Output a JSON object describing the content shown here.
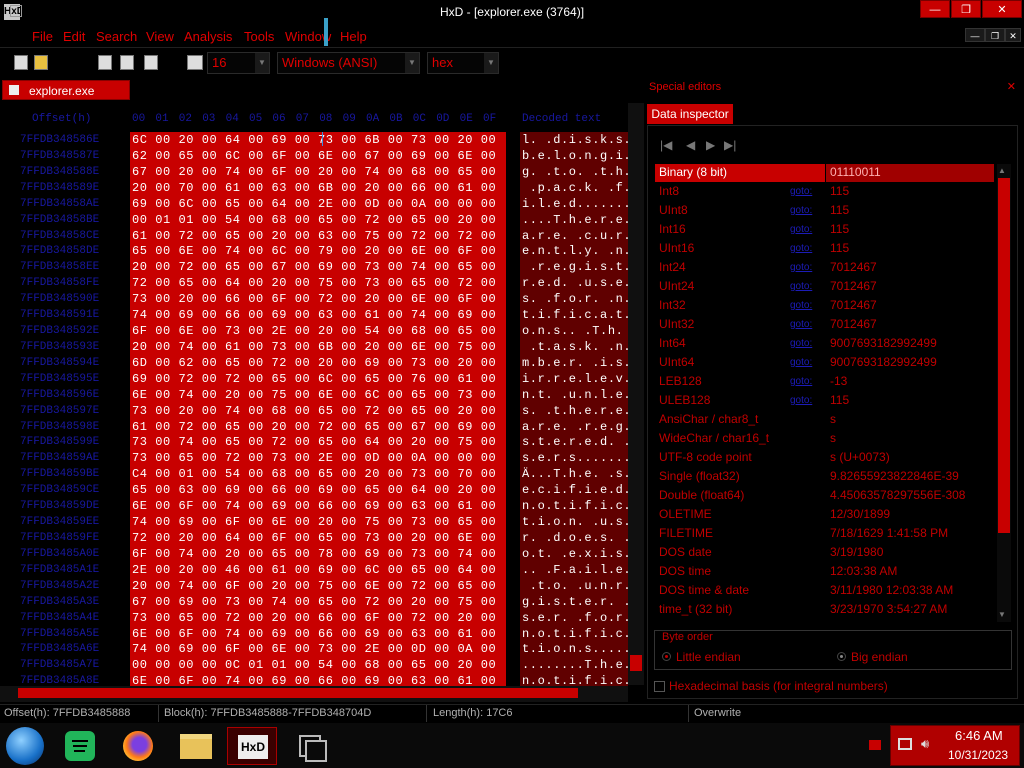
{
  "window": {
    "title": "HxD - [explorer.exe (3764)]",
    "logo_text": "HxD",
    "controls": [
      "—",
      "❐",
      "✕"
    ],
    "doc_controls": [
      "—",
      "❐",
      "✕"
    ]
  },
  "menu": [
    "File",
    "Edit",
    "Search",
    "View",
    "Analysis",
    "Tools",
    "Window",
    "Help"
  ],
  "toolbar": {
    "bytes_per_row": "16",
    "charset": "Windows (ANSI)",
    "display_mode": "hex"
  },
  "document_tab": "explorer.exe (3764)",
  "hex_view": {
    "header_offset": "Offset(h)",
    "header_columns": [
      "00",
      "01",
      "02",
      "03",
      "04",
      "05",
      "06",
      "07",
      "08",
      "09",
      "0A",
      "0B",
      "0C",
      "0D",
      "0E",
      "0F"
    ],
    "header_text": "Decoded text",
    "rows": [
      {
        "offset": "7FFDB348586E",
        "hex": "6C 00 20 00 64 00 69 00 73 00 6B 00 73 00 20 00",
        "text": "l. .d.i.s.k.s."
      },
      {
        "offset": "7FFDB348587E",
        "hex": "62 00 65 00 6C 00 6F 00 6E 00 67 00 69 00 6E 00",
        "text": "b.e.l.o.n.g.i."
      },
      {
        "offset": "7FFDB348588E",
        "hex": "67 00 20 00 74 00 6F 00 20 00 74 00 68 00 65 00",
        "text": "g. .t.o. .t.h."
      },
      {
        "offset": "7FFDB348589E",
        "hex": "20 00 70 00 61 00 63 00 6B 00 20 00 66 00 61 00",
        "text": " .p.a.c.k. .f."
      },
      {
        "offset": "7FFDB34858AE",
        "hex": "69 00 6C 00 65 00 64 00 2E 00 0D 00 0A 00 00 00",
        "text": "i.l.e.d......."
      },
      {
        "offset": "7FFDB34858BE",
        "hex": "00 01 01 00 54 00 68 00 65 00 72 00 65 00 20 00",
        "text": "....T.h.e.r.e."
      },
      {
        "offset": "7FFDB34858CE",
        "hex": "61 00 72 00 65 00 20 00 63 00 75 00 72 00 72 00",
        "text": "a.r.e. .c.u.r."
      },
      {
        "offset": "7FFDB34858DE",
        "hex": "65 00 6E 00 74 00 6C 00 79 00 20 00 6E 00 6F 00",
        "text": "e.n.t.l.y. .n."
      },
      {
        "offset": "7FFDB34858EE",
        "hex": "20 00 72 00 65 00 67 00 69 00 73 00 74 00 65 00",
        "text": " .r.e.g.i.s.t."
      },
      {
        "offset": "7FFDB34858FE",
        "hex": "72 00 65 00 64 00 20 00 75 00 73 00 65 00 72 00",
        "text": "r.e.d. .u.s.e."
      },
      {
        "offset": "7FFDB348590E",
        "hex": "73 00 20 00 66 00 6F 00 72 00 20 00 6E 00 6F 00",
        "text": "s. .f.o.r. .n."
      },
      {
        "offset": "7FFDB348591E",
        "hex": "74 00 69 00 66 00 69 00 63 00 61 00 74 00 69 00",
        "text": "t.i.f.i.c.a.t."
      },
      {
        "offset": "7FFDB348592E",
        "hex": "6F 00 6E 00 73 00 2E 00 20 00 54 00 68 00 65 00",
        "text": "o.n.s.. .T.h."
      },
      {
        "offset": "7FFDB348593E",
        "hex": "20 00 74 00 61 00 73 00 6B 00 20 00 6E 00 75 00",
        "text": " .t.a.s.k. .n."
      },
      {
        "offset": "7FFDB348594E",
        "hex": "6D 00 62 00 65 00 72 00 20 00 69 00 73 00 20 00",
        "text": "m.b.e.r. .i.s."
      },
      {
        "offset": "7FFDB348595E",
        "hex": "69 00 72 00 72 00 65 00 6C 00 65 00 76 00 61 00",
        "text": "i.r.r.e.l.e.v."
      },
      {
        "offset": "7FFDB348596E",
        "hex": "6E 00 74 00 20 00 75 00 6E 00 6C 00 65 00 73 00",
        "text": "n.t. .u.n.l.e."
      },
      {
        "offset": "7FFDB348597E",
        "hex": "73 00 20 00 74 00 68 00 65 00 72 00 65 00 20 00",
        "text": "s. .t.h.e.r.e."
      },
      {
        "offset": "7FFDB348598E",
        "hex": "61 00 72 00 65 00 20 00 72 00 65 00 67 00 69 00",
        "text": "a.r.e. .r.e.g."
      },
      {
        "offset": "7FFDB348599E",
        "hex": "73 00 74 00 65 00 72 00 65 00 64 00 20 00 75 00",
        "text": "s.t.e.r.e.d. ."
      },
      {
        "offset": "7FFDB34859AE",
        "hex": "73 00 65 00 72 00 73 00 2E 00 0D 00 0A 00 00 00",
        "text": "s.e.r.s......."
      },
      {
        "offset": "7FFDB34859BE",
        "hex": "C4 00 01 00 54 00 68 00 65 00 20 00 73 00 70 00",
        "text": "Ä...T.h.e. .s."
      },
      {
        "offset": "7FFDB34859CE",
        "hex": "65 00 63 00 69 00 66 00 69 00 65 00 64 00 20 00",
        "text": "e.c.i.f.i.e.d."
      },
      {
        "offset": "7FFDB34859DE",
        "hex": "6E 00 6F 00 74 00 69 00 66 00 69 00 63 00 61 00",
        "text": "n.o.t.i.f.i.c."
      },
      {
        "offset": "7FFDB34859EE",
        "hex": "74 00 69 00 6F 00 6E 00 20 00 75 00 73 00 65 00",
        "text": "t.i.o.n. .u.s."
      },
      {
        "offset": "7FFDB34859FE",
        "hex": "72 00 20 00 64 00 6F 00 65 00 73 00 20 00 6E 00",
        "text": "r. .d.o.e.s. ."
      },
      {
        "offset": "7FFDB3485A0E",
        "hex": "6F 00 74 00 20 00 65 00 78 00 69 00 73 00 74 00",
        "text": "o.t. .e.x.i.s."
      },
      {
        "offset": "7FFDB3485A1E",
        "hex": "2E 00 20 00 46 00 61 00 69 00 6C 00 65 00 64 00",
        "text": ".. .F.a.i.l.e."
      },
      {
        "offset": "7FFDB3485A2E",
        "hex": "20 00 74 00 6F 00 20 00 75 00 6E 00 72 00 65 00",
        "text": " .t.o. .u.n.r."
      },
      {
        "offset": "7FFDB3485A3E",
        "hex": "67 00 69 00 73 00 74 00 65 00 72 00 20 00 75 00",
        "text": "g.i.s.t.e.r. ."
      },
      {
        "offset": "7FFDB3485A4E",
        "hex": "73 00 65 00 72 00 20 00 66 00 6F 00 72 00 20 00",
        "text": "s.e.r. .f.o.r."
      },
      {
        "offset": "7FFDB3485A5E",
        "hex": "6E 00 6F 00 74 00 69 00 66 00 69 00 63 00 61 00",
        "text": "n.o.t.i.f.i.c."
      },
      {
        "offset": "7FFDB3485A6E",
        "hex": "74 00 69 00 6F 00 6E 00 73 00 2E 00 0D 00 0A 00",
        "text": "t.i.o.n.s....."
      },
      {
        "offset": "7FFDB3485A7E",
        "hex": "00 00 00 00 0C 01 01 00 54 00 68 00 65 00 20 00",
        "text": "........T.h.e."
      },
      {
        "offset": "7FFDB3485A8E",
        "hex": "6E 00 6F 00 74 00 69 00 66 00 69 00 63 00 61 00",
        "text": "n.o.t.i.f.i.c."
      }
    ]
  },
  "special_editors": {
    "title": "Special editors",
    "tab": "Data inspector",
    "nav": [
      "|◀",
      "◀",
      "▶",
      "▶|"
    ],
    "rows": [
      {
        "name": "Binary (8 bit)",
        "link": "",
        "value": "01110011",
        "selected": true
      },
      {
        "name": "Int8",
        "link": "goto:",
        "value": "115"
      },
      {
        "name": "UInt8",
        "link": "goto:",
        "value": "115"
      },
      {
        "name": "Int16",
        "link": "goto:",
        "value": "115"
      },
      {
        "name": "UInt16",
        "link": "goto:",
        "value": "115"
      },
      {
        "name": "Int24",
        "link": "goto:",
        "value": "7012467"
      },
      {
        "name": "UInt24",
        "link": "goto:",
        "value": "7012467"
      },
      {
        "name": "Int32",
        "link": "goto:",
        "value": "7012467"
      },
      {
        "name": "UInt32",
        "link": "goto:",
        "value": "7012467"
      },
      {
        "name": "Int64",
        "link": "goto:",
        "value": "9007693182992499"
      },
      {
        "name": "UInt64",
        "link": "goto:",
        "value": "9007693182992499"
      },
      {
        "name": "LEB128",
        "link": "goto:",
        "value": "-13"
      },
      {
        "name": "ULEB128",
        "link": "goto:",
        "value": "115"
      },
      {
        "name": "AnsiChar / char8_t",
        "link": "",
        "value": "s"
      },
      {
        "name": "WideChar / char16_t",
        "link": "",
        "value": "s"
      },
      {
        "name": "UTF-8 code point",
        "link": "",
        "value": "s (U+0073)"
      },
      {
        "name": "Single (float32)",
        "link": "",
        "value": "9.82655923822846E-39"
      },
      {
        "name": "Double (float64)",
        "link": "",
        "value": "4.45063578297556E-308"
      },
      {
        "name": "OLETIME",
        "link": "",
        "value": "12/30/1899"
      },
      {
        "name": "FILETIME",
        "link": "",
        "value": "7/18/1629 1:41:58 PM"
      },
      {
        "name": "DOS date",
        "link": "",
        "value": "3/19/1980"
      },
      {
        "name": "DOS time",
        "link": "",
        "value": "12:03:38 AM"
      },
      {
        "name": "DOS time & date",
        "link": "",
        "value": "3/11/1980 12:03:38 AM"
      },
      {
        "name": "time_t (32 bit)",
        "link": "",
        "value": "3/23/1970 3:54:27 AM"
      }
    ],
    "byte_order": {
      "label": "Byte order",
      "little": "Little endian",
      "big": "Big endian",
      "selected": "little"
    },
    "hex_basis": "Hexadecimal basis (for integral numbers)"
  },
  "status_bar": {
    "offset": "Offset(h): 7FFDB3485888",
    "block": "Block(h): 7FFDB3485888-7FFDB348704D",
    "length": "Length(h): 17C6",
    "mode": "Overwrite"
  },
  "taskbar": {
    "apps": [
      "start-orb",
      "spotify",
      "firefox",
      "file-explorer",
      "hxd",
      "task-view"
    ],
    "time": "6:46 AM",
    "date": "10/31/2023"
  },
  "colors": {
    "accent": "#c80000",
    "dark_accent": "#600000",
    "link": "#1c1cb8",
    "background": "#000000"
  }
}
